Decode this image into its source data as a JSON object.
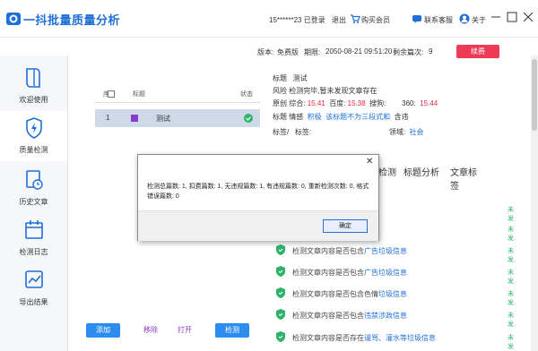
{
  "app": {
    "title": "一抖批量质量分析",
    "user": "15******23 已登录",
    "logout": "退出",
    "buy": "购买会员",
    "support": "联系客服",
    "about": "关于"
  },
  "info": {
    "version_label": "版本:",
    "version": "免费版",
    "expire_label": "期限:",
    "expire": "2050-08-21 09:51:20",
    "remaining_label": "剩余篇次:",
    "remaining": "9",
    "renew": "续费"
  },
  "sidebar": {
    "items": [
      {
        "label": "欢迎使用",
        "icon": "book-icon"
      },
      {
        "label": "质量检测",
        "icon": "shield-bolt-icon"
      },
      {
        "label": "历史文章",
        "icon": "clock-document-icon"
      },
      {
        "label": "检测日志",
        "icon": "calendar-icon"
      },
      {
        "label": "导出结果",
        "icon": "chart-icon"
      }
    ]
  },
  "table": {
    "headers": [
      "序号",
      "标题",
      "状态"
    ],
    "rows": [
      {
        "index": "1",
        "title": "测试",
        "status": "ok"
      }
    ]
  },
  "details": {
    "title_label": "标题",
    "title_value": "测试",
    "risk_label": "风险",
    "risk_value": "检测完毕,暂未发现文章存在",
    "original_label": "原创",
    "composite_label": "综合:",
    "composite": "15.41",
    "baidu_label": "百度:",
    "baidu": "15.38",
    "sogou_label": "搜狗:",
    "s360_label": "360:",
    "s360": "15.44",
    "tags_label": "标题",
    "emotion_label": "情感",
    "emotion": "积极",
    "title_tip": "该标题不为三段式和",
    "contains": "含违",
    "tag_label": "标签/",
    "tag_sign": "标签:",
    "domain_label": "领域:",
    "domain": "社会"
  },
  "tabs": [
    "检测",
    "标题分析",
    "文章标签"
  ],
  "checks": [
    {
      "pre": "",
      "hl": "",
      "status": "未发"
    },
    {
      "pre": "",
      "hl": "",
      "status": "未发"
    },
    {
      "pre": "检测文章内容是否包含",
      "hl": "广告垃圾信息",
      "status": "未发"
    },
    {
      "pre": "检测文章内容是否包含",
      "hl": "广告垃圾信息",
      "status": "未发"
    },
    {
      "pre": "检测文章内容是否包含色情",
      "hl": "垃圾信息",
      "status": "未发"
    },
    {
      "pre": "检测文章内容是否包含",
      "hl": "违禁涉政信息",
      "status": "未发"
    },
    {
      "pre": "检测文章内容是否存在",
      "hl": "谩骂、灌水等垃圾信息",
      "status": "未发"
    }
  ],
  "buttons": {
    "add": "添加",
    "remove": "移除",
    "open": "打开",
    "check": "检测"
  },
  "dialog": {
    "message": "检测总篇数: 1, 扣费篇数: 1, 无违规篇数: 1, 有违规篇数: 0, 重新检测次数: 0, 格式错误篇数: 0",
    "ok": "确定"
  },
  "bottom_text": "",
  "colors": {
    "brand": "#1e6fd9",
    "accent_red": "#e0283c",
    "renew": "#ee3b55",
    "pass_green": "#2db36a",
    "selected_row": "#cfd9e8"
  }
}
